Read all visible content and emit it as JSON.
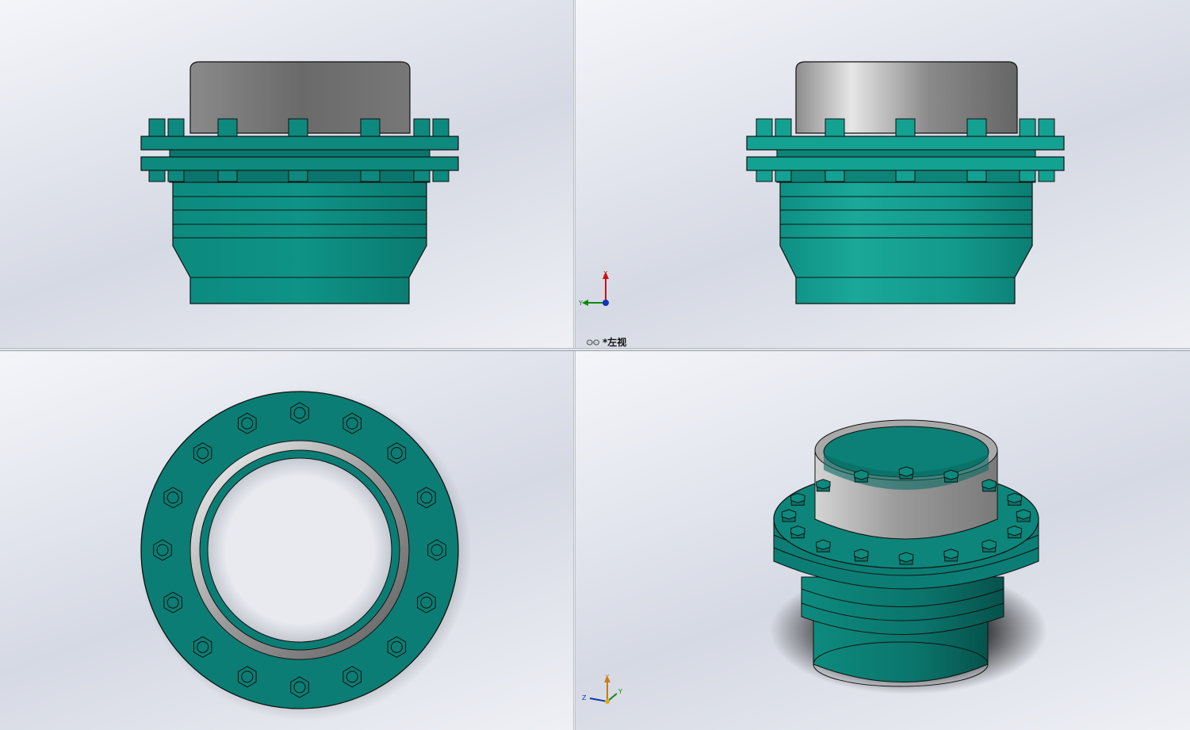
{
  "viewports": {
    "top_left": {
      "name": "front-view"
    },
    "top_right": {
      "name": "left-view",
      "view_label": "*左视",
      "triad": {
        "up": "X",
        "left": "Y"
      }
    },
    "bottom_left": {
      "name": "top-view"
    },
    "bottom_right": {
      "name": "isometric-view",
      "triad": {
        "up": "X",
        "left": "Z",
        "right": "Y"
      }
    }
  },
  "colors": {
    "teal": "#0b7d74",
    "teal_light": "#17a597",
    "steel_dark": "#6d6d6d",
    "steel_light": "#d9d9d9",
    "outline": "#0a0a0a"
  },
  "icons": [
    "glasses-icon",
    "coordinate-triad-icon"
  ]
}
